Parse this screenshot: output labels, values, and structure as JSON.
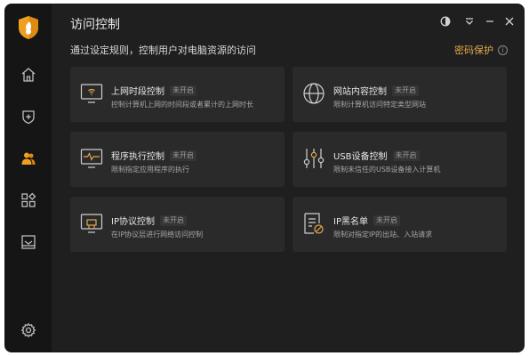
{
  "app": {
    "title": "访问控制"
  },
  "sidebar": {
    "items": [
      {
        "name": "home",
        "icon": "home-icon"
      },
      {
        "name": "protection",
        "icon": "shield-plus-icon"
      },
      {
        "name": "access-control",
        "icon": "users-icon",
        "active": true
      },
      {
        "name": "apps",
        "icon": "apps-icon"
      },
      {
        "name": "inbox",
        "icon": "inbox-icon"
      }
    ],
    "settings_icon": "gear-icon"
  },
  "header": {
    "subtitle": "通过设定规则，控制用户对电脑资源的访问",
    "password_link": "密码保护",
    "info_icon": "i"
  },
  "cards": [
    {
      "title": "上网时段控制",
      "status": "未开启",
      "desc": "控制计算机上网的时间段或者累计的上网时长",
      "icon": "monitor-wifi-icon"
    },
    {
      "title": "网站内容控制",
      "status": "未开启",
      "desc": "限制计算机访问特定类型网站",
      "icon": "globe-icon"
    },
    {
      "title": "程序执行控制",
      "status": "未开启",
      "desc": "限制指定应用程序的执行",
      "icon": "program-monitor-icon"
    },
    {
      "title": "USB设备控制",
      "status": "未开启",
      "desc": "限制未信任的USB设备接入计算机",
      "icon": "sliders-icon"
    },
    {
      "title": "IP协议控制",
      "status": "未开启",
      "desc": "在IP协议层进行网络访问控制",
      "icon": "ip-monitor-icon"
    },
    {
      "title": "IP黑名单",
      "status": "未开启",
      "desc": "限制对指定IP的出站、入站请求",
      "icon": "blacklist-doc-icon"
    }
  ],
  "colors": {
    "accent": "#e2a84b",
    "window_bg": "#1f1f1f",
    "sidebar_bg": "#151515",
    "card_bg": "#2a2a2a"
  }
}
